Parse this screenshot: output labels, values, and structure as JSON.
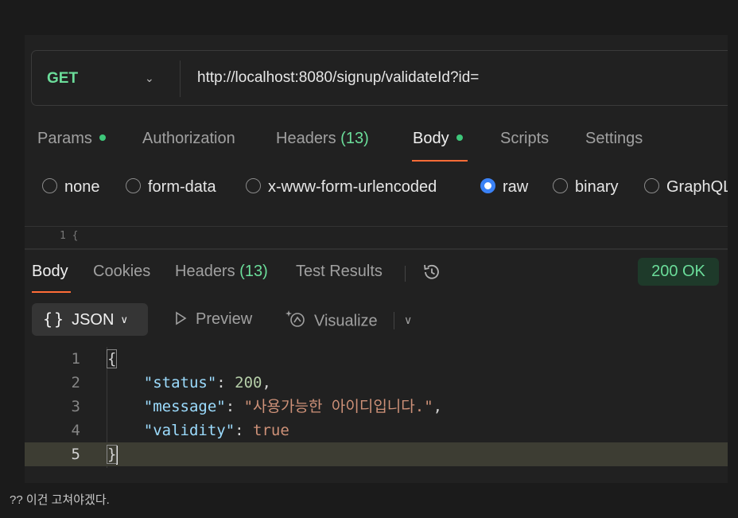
{
  "request": {
    "method": "GET",
    "url": "http://localhost:8080/signup/validateId?id="
  },
  "request_tabs": {
    "params": "Params",
    "authorization": "Authorization",
    "headers": "Headers",
    "headers_count": "(13)",
    "body": "Body",
    "scripts": "Scripts",
    "settings": "Settings"
  },
  "body_types": {
    "none": "none",
    "form_data": "form-data",
    "urlencoded": "x-www-form-urlencoded",
    "raw": "raw",
    "binary": "binary",
    "graphql": "GraphQL",
    "selected": "raw"
  },
  "request_editor_peek": "1   {",
  "response_tabs": {
    "body": "Body",
    "cookies": "Cookies",
    "headers": "Headers",
    "headers_count": "(13)",
    "test_results": "Test Results"
  },
  "status": "200 OK",
  "view": {
    "format": "JSON",
    "braces": "{}",
    "preview": "Preview",
    "visualize": "Visualize"
  },
  "code_lines": {
    "l1_num": "1",
    "l1": "{",
    "l2_num": "2",
    "l2_key": "\"status\"",
    "l2_val": "200",
    "l3_num": "3",
    "l3_key": "\"message\"",
    "l3_val": "\"사용가능한 아이디입니다.\"",
    "l4_num": "4",
    "l4_key": "\"validity\"",
    "l4_val": "true",
    "l5_num": "5",
    "l5": "}"
  },
  "caption": "?? 이건 고쳐야겠다.",
  "colors": {
    "accent": "#ff6c37",
    "method_green": "#6bdd9a",
    "radio_blue": "#3b82f6"
  }
}
